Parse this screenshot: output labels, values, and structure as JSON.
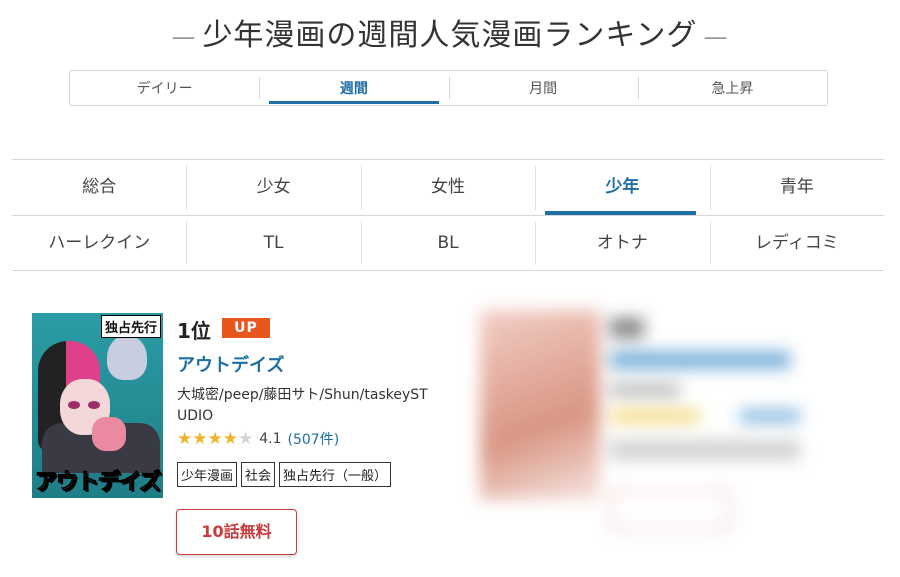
{
  "page": {
    "title": "少年漫画の週間人気漫画ランキング",
    "dash": "—"
  },
  "period_tabs": [
    {
      "label": "デイリー",
      "active": false
    },
    {
      "label": "週間",
      "active": true
    },
    {
      "label": "月間",
      "active": false
    },
    {
      "label": "急上昇",
      "active": false
    }
  ],
  "genres": {
    "row1": [
      {
        "label": "総合",
        "active": false
      },
      {
        "label": "少女",
        "active": false
      },
      {
        "label": "女性",
        "active": false
      },
      {
        "label": "少年",
        "active": true
      },
      {
        "label": "青年",
        "active": false
      }
    ],
    "row2": [
      {
        "label": "ハーレクイン",
        "active": false
      },
      {
        "label": "TL",
        "active": false
      },
      {
        "label": "BL",
        "active": false
      },
      {
        "label": "オトナ",
        "active": false
      },
      {
        "label": "レディコミ",
        "active": false
      }
    ]
  },
  "ranking": [
    {
      "rank": "1位",
      "badge": "UP",
      "title": "アウトデイズ",
      "cover_label": "独占先行",
      "cover_title": "アウトデイズ",
      "authors": "大城密/peep/藤田サト/Shun/taskeySTUDIO",
      "rating": 4.1,
      "rating_text": "4.1",
      "review_count": "(507件)",
      "tags": [
        "少年漫画",
        "社会",
        "独占先行（一般）"
      ],
      "button_label": "10話無料"
    }
  ],
  "colors": {
    "accent": "#1d6fa5",
    "badge": "#e8561e",
    "button": "#c93b3b",
    "star": "#f0b429"
  }
}
